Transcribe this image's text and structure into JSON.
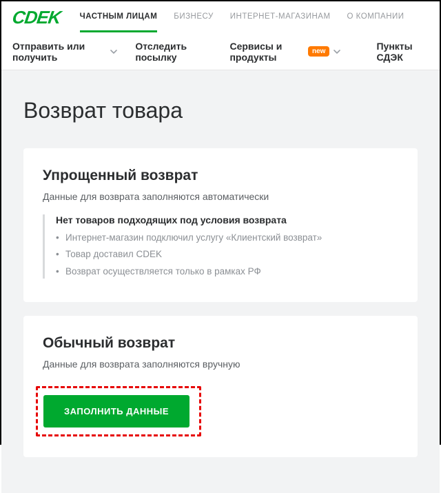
{
  "logo": "CDEK",
  "topnav": {
    "items": [
      {
        "label": "ЧАСТНЫМ ЛИЦАМ",
        "active": true
      },
      {
        "label": "БИЗНЕСУ",
        "active": false
      },
      {
        "label": "ИНТЕРНЕТ-МАГАЗИНАМ",
        "active": false
      },
      {
        "label": "О КОМПАНИИ",
        "active": false
      }
    ]
  },
  "subnav": {
    "send_receive": "Отправить или получить",
    "track": "Отследить посылку",
    "services": "Сервисы и продукты",
    "services_badge": "new",
    "points": "Пункты СДЭК"
  },
  "page": {
    "title": "Возврат товара"
  },
  "cards": {
    "simplified": {
      "title": "Упрощенный возврат",
      "subtitle": "Данные для возврата заполняются автоматически",
      "note_heading": "Нет товаров подходящих под условия возврата",
      "bullets": [
        "Интернет-магазин подключил услугу «Клиентский возврат»",
        "Товар доставил CDEK",
        "Возврат осуществляется только в рамках РФ"
      ]
    },
    "regular": {
      "title": "Обычный возврат",
      "subtitle": "Данные для возврата заполняются вручную",
      "button": "ЗАПОЛНИТЬ ДАННЫЕ"
    }
  },
  "colors": {
    "brand": "#00a92f",
    "badge": "#ff7a00",
    "highlight_border": "#e60000"
  }
}
